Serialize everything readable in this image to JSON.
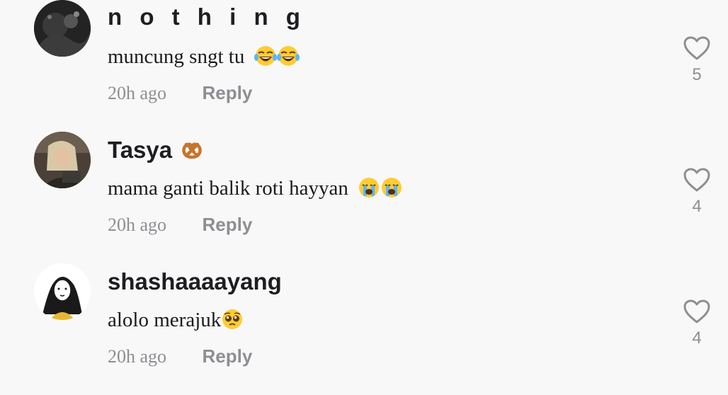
{
  "comments": [
    {
      "username": "n o t h i n g",
      "badge": "",
      "text": "muncung sngt tu",
      "emojis": [
        "tears-of-joy-emoji",
        "tears-of-joy-emoji"
      ],
      "time": "20h ago",
      "reply_label": "Reply",
      "likes": "5"
    },
    {
      "username": "Tasya",
      "badge": "pretzel-emoji",
      "text": "mama ganti balik roti hayyan",
      "emojis": [
        "loudly-crying-emoji",
        "loudly-crying-emoji"
      ],
      "time": "20h ago",
      "reply_label": "Reply",
      "likes": "4"
    },
    {
      "username": "shashaaaayang",
      "badge": "",
      "text": "alolo merajuk",
      "emojis": [
        "pleading-face-emoji"
      ],
      "time": "20h ago",
      "reply_label": "Reply",
      "likes": "4"
    }
  ],
  "colors": {
    "background": "#f8f8f8",
    "username": "#1d1d22",
    "secondary": "#8e8e93"
  }
}
